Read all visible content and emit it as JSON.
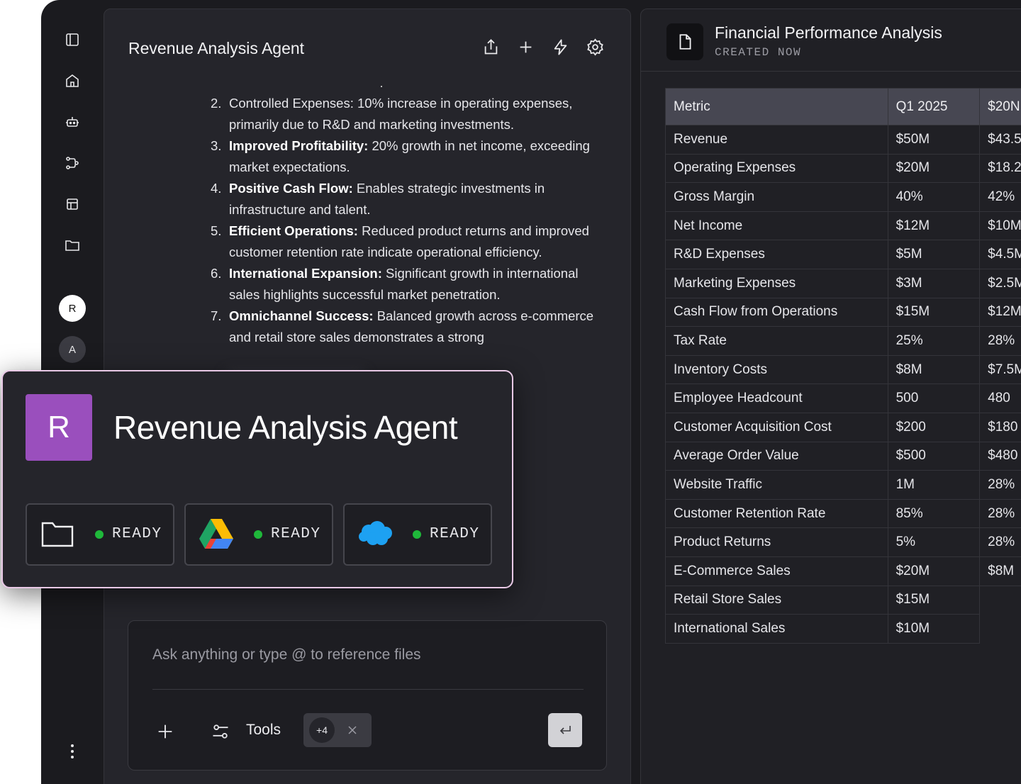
{
  "sidebar": {
    "icons": [
      "sidebar-toggle-icon",
      "home-icon",
      "robot-icon",
      "workflow-icon",
      "table-icon",
      "folder-icon"
    ],
    "avatars": [
      "R",
      "A"
    ]
  },
  "chat": {
    "title": "Revenue Analysis Agent",
    "actions": [
      "share-icon",
      "plus-icon",
      "lightning-icon",
      "settings-icon"
    ],
    "items": [
      {
        "num": "2.",
        "bold": "",
        "text": "Controlled Expenses: 10% increase in operating expenses, primarily due to R&D and marketing investments."
      },
      {
        "num": "3.",
        "bold": "Improved Profitability:",
        "text": " 20% growth in net income, exceeding market expectations."
      },
      {
        "num": "4.",
        "bold": "Positive Cash Flow:",
        "text": " Enables strategic investments in infrastructure and talent."
      },
      {
        "num": "5.",
        "bold": "Efficient Operations:",
        "text": " Reduced product returns and improved customer retention rate indicate operational efficiency."
      },
      {
        "num": "6.",
        "bold": "International Expansion:",
        "text": " Significant growth in international sales highlights successful market penetration."
      },
      {
        "num": "7.",
        "bold": "Omnichannel Success:",
        "text": " Balanced growth across e-commerce and retail store sales demonstrates a strong"
      }
    ]
  },
  "composer": {
    "placeholder": "Ask anything or type @ to reference files",
    "tools_label": "Tools",
    "chip_count": "+4"
  },
  "overlay": {
    "badge": "R",
    "title": "Revenue Analysis Agent",
    "integrations": [
      {
        "name": "folder",
        "status": "READY"
      },
      {
        "name": "google-drive",
        "status": "READY"
      },
      {
        "name": "salesforce",
        "status": "READY"
      }
    ],
    "status_color": "#1fb83a"
  },
  "document": {
    "title": "Financial Performance Analysis",
    "subtitle": "CREATED NOW",
    "columns": [
      "Metric",
      "Q1 2025",
      "$20N"
    ],
    "rows": [
      [
        "Revenue",
        "$50M",
        "$43.5"
      ],
      [
        "Operating Expenses",
        "$20M",
        "$18.2"
      ],
      [
        "Gross Margin",
        "40%",
        "42%"
      ],
      [
        "Net Income",
        "$12M",
        "$10M"
      ],
      [
        "R&D Expenses",
        "$5M",
        "$4.5M"
      ],
      [
        "Marketing Expenses",
        "$3M",
        "$2.5M"
      ],
      [
        "Cash Flow from Operations",
        "$15M",
        "$12M"
      ],
      [
        "Tax Rate",
        "25%",
        "28%"
      ],
      [
        "Inventory Costs",
        "$8M",
        "$7.5M"
      ],
      [
        "Employee Headcount",
        "500",
        "480"
      ],
      [
        "Customer Acquisition Cost",
        "$200",
        "$180"
      ],
      [
        "Average Order Value",
        "$500",
        "$480"
      ],
      [
        "Website Traffic",
        "1M",
        "28%"
      ],
      [
        "Customer Retention Rate",
        "85%",
        "28%"
      ],
      [
        "Product Returns",
        "5%",
        "28%"
      ],
      [
        "E-Commerce Sales",
        "$20M",
        "$8M"
      ],
      [
        "Retail Store Sales",
        "$15M",
        ""
      ],
      [
        "International Sales",
        "$10M",
        ""
      ]
    ]
  }
}
